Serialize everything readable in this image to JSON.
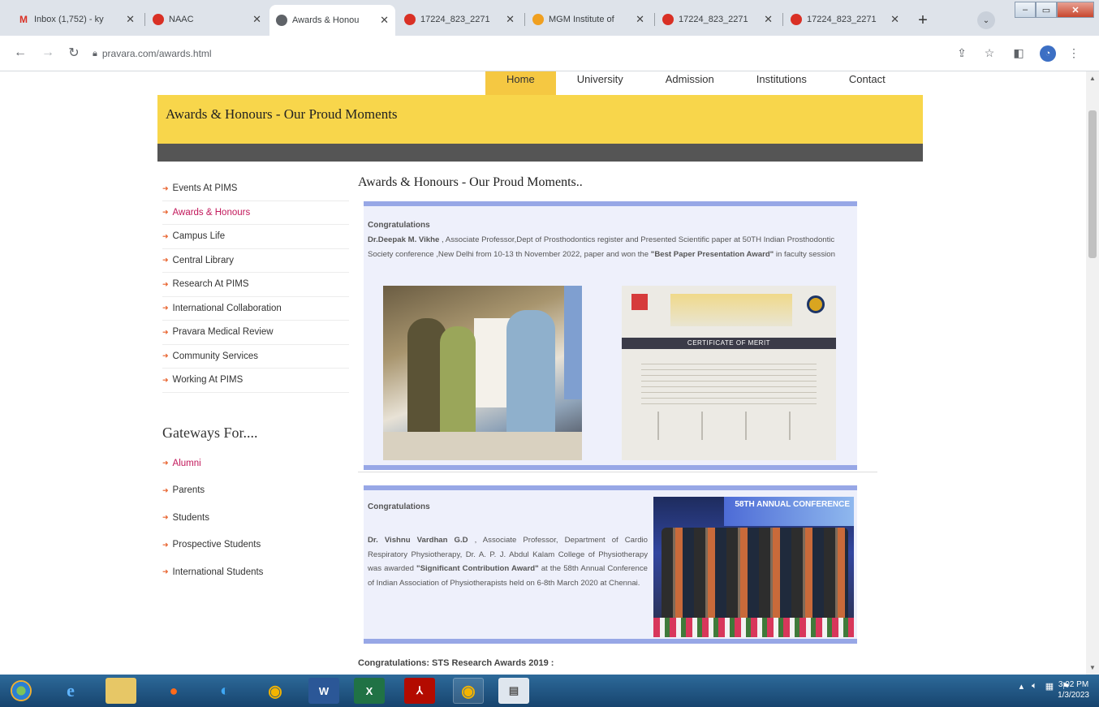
{
  "browser": {
    "tabs": [
      {
        "title": "Inbox (1,752) - ky",
        "icon": "gmail-icon",
        "color": "#d93025",
        "glyph": "M"
      },
      {
        "title": "NAAC",
        "icon": "red-logo-icon",
        "color": "#d93025",
        "glyph": "◉"
      },
      {
        "title": "Awards & Honou",
        "icon": "globe-icon",
        "color": "#444444",
        "glyph": "◍"
      },
      {
        "title": "17224_823_2271",
        "icon": "red-logo-icon",
        "color": "#d93025",
        "glyph": "◉"
      },
      {
        "title": "MGM Institute of",
        "icon": "mgm-logo-icon",
        "color": "#f0a020",
        "glyph": "●"
      },
      {
        "title": "17224_823_2271",
        "icon": "red-logo-icon",
        "color": "#d93025",
        "glyph": "◉"
      },
      {
        "title": "17224_823_2271",
        "icon": "red-logo-icon",
        "color": "#d93025",
        "glyph": "◉"
      }
    ],
    "url": "pravara.com/awards.html"
  },
  "site": {
    "nav": [
      "Home",
      "University",
      "Admission",
      "Institutions",
      "Contact"
    ],
    "banner_title": "Awards & Honours - Our Proud Moments",
    "left_menu": [
      "Events At PIMS",
      "Awards & Honours",
      "Campus Life",
      "Central Library",
      "Research At PIMS",
      "International Collaboration",
      "Pravara Medical Review",
      "Community Services",
      "Working At PIMS"
    ],
    "gateways_heading": "Gateways For....",
    "gateways": [
      "Alumni",
      "Parents",
      "Students",
      "Prospective Students",
      "International Students"
    ],
    "content_title": "Awards & Honours - Our Proud Moments..",
    "card1": {
      "label": "Congratulations",
      "name": "Dr.Deepak M. Vikhe",
      "text": " , Associate Professor,Dept of Prosthodontics register and Presented Scientific paper at 50TH Indian Prosthodontic Society conference ,New Delhi from 10-13 th November 2022, paper and won the ",
      "award": "\"Best Paper Presentation Award\"",
      "tail": " in faculty session",
      "certificate_band": "CERTIFICATE OF MERIT"
    },
    "card2": {
      "label": "Congratulations",
      "name": "Dr. Vishnu Vardhan G.D",
      "text": " , Associate Professor, Department of Cardio Respiratory Physiotherapy, Dr. A. P. J. Abdul Kalam College of Physiotherapy was awarded ",
      "award": "\"Significant Contribution Award\"",
      "tail": " at the 58th Annual Conference of Indian Association of Physiotherapists held on 6-8th March 2020 at Chennai.",
      "photo_banner": "58TH ANNUAL CONFERENCE"
    },
    "sts": "Congratulations: STS Research Awards 2019 :"
  },
  "taskbar": {
    "time": "3:02 PM",
    "date": "1/3/2023"
  },
  "colors": {
    "banner": "#f8d64b",
    "dark_bar": "#555555",
    "card_border": "#97a7e6",
    "card_bg": "#eef0fb",
    "menu_arrow": "#e8622c",
    "active_menu": "#c2185b"
  }
}
